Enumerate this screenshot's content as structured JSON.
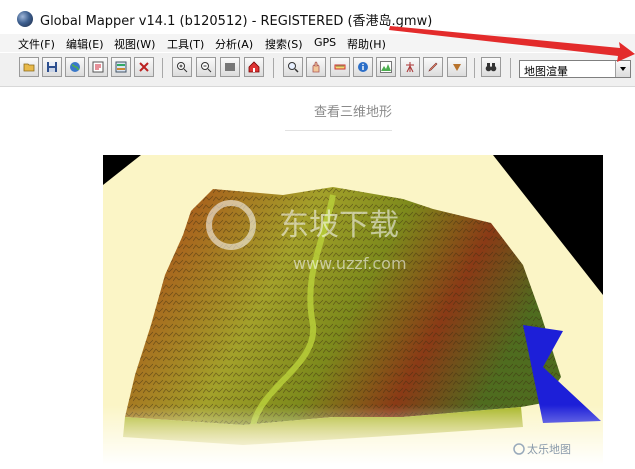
{
  "window": {
    "title": "Global Mapper v14.1 (b120512) - REGISTERED (香港岛.gmw)",
    "icon": "globe-icon"
  },
  "menubar": {
    "items": [
      "文件(F)",
      "编辑(E)",
      "视图(W)",
      "工具(T)",
      "分析(A)",
      "搜索(S)",
      "GPS",
      "帮助(H)"
    ]
  },
  "toolbar": {
    "buttons": [
      "open-folder-icon",
      "save-icon",
      "globe-icon",
      "layers-icon",
      "control-center-icon",
      "config-icon",
      "zoom-in-icon",
      "zoom-out-icon",
      "full-view-icon",
      "home-icon",
      "zoom-tool-icon",
      "pan-hand-icon",
      "measure-icon",
      "info-icon",
      "path-profile-icon",
      "view-shed-icon",
      "digitizer-icon",
      "down-arrow-icon",
      "binoculars-icon"
    ],
    "render_mode": "地图渲暈"
  },
  "annotation": {
    "arrow_color": "#e32b2b"
  },
  "article": {
    "caption": "查看三维地形"
  },
  "view3d": {
    "watermark_main": "东坡下载",
    "watermark_sub": "www.uzzf.com",
    "corner_logo": "太乐地图"
  }
}
